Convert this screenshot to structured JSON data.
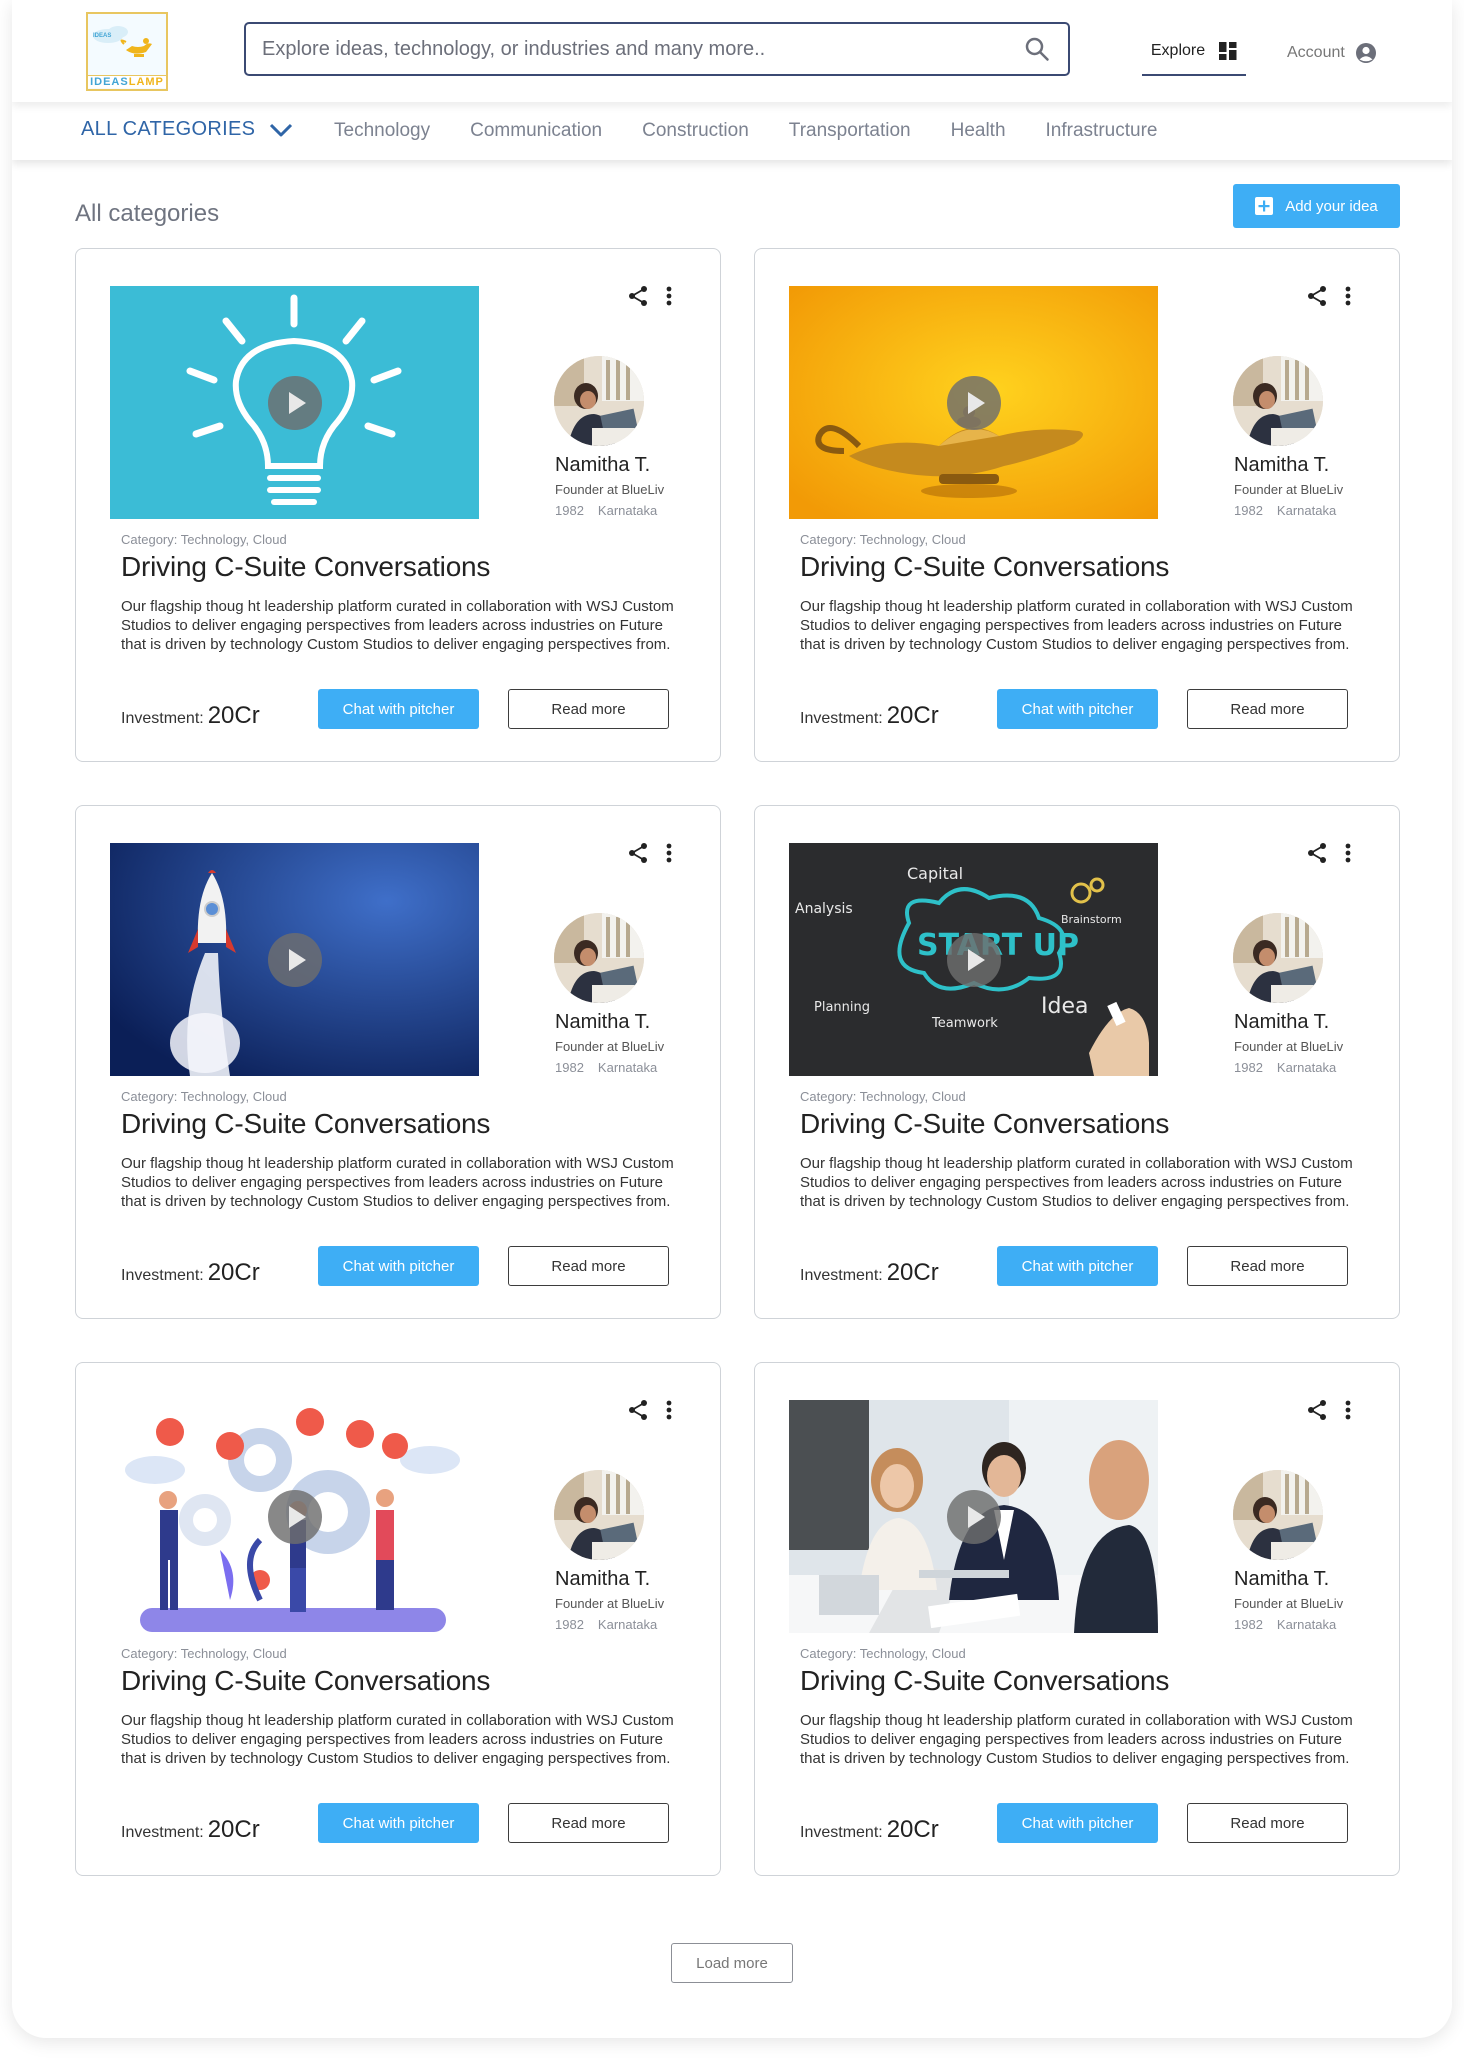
{
  "header": {
    "logo_text_main": "IDEAS",
    "logo_text_accent": "LAMP",
    "logo_small": "IDEAS",
    "search_placeholder": "Explore ideas, technology, or industries and many more..",
    "explore_label": "Explore",
    "account_label": "Account"
  },
  "category_nav": {
    "all_label": "ALL CATEGORIES",
    "links": [
      "Technology",
      "Communication",
      "Construction",
      "Transportation",
      "Health",
      "Infrastructure"
    ]
  },
  "main": {
    "section_title": "All categories",
    "add_button_label": "Add your idea",
    "load_more_label": "Load more"
  },
  "cards": [
    {
      "media": "lightbulb",
      "person_name": "Namitha T.",
      "person_role": "Founder at BlueLiv",
      "person_year": "1982",
      "person_location": "Karnataka",
      "category": "Category: Technology, Cloud",
      "title": "Driving C-Suite Conversations",
      "description": "Our flagship thoug ht leadership platform curated in collaboration with WSJ Custom Studios to deliver engaging perspectives from leaders across industries on Future that is driven by technology Custom Studios to deliver engaging perspectives from.",
      "investment_label": "Investment:",
      "investment_value": "20Cr",
      "chat_label": "Chat with pitcher",
      "read_label": "Read more"
    },
    {
      "media": "lamp",
      "person_name": "Namitha T.",
      "person_role": "Founder at BlueLiv",
      "person_year": "1982",
      "person_location": "Karnataka",
      "category": "Category: Technology, Cloud",
      "title": "Driving C-Suite Conversations",
      "description": "Our flagship thoug ht leadership platform curated in collaboration with WSJ Custom Studios to deliver engaging perspectives from leaders across industries on Future that is driven by technology Custom Studios to deliver engaging perspectives from.",
      "investment_label": "Investment:",
      "investment_value": "20Cr",
      "chat_label": "Chat with pitcher",
      "read_label": "Read more"
    },
    {
      "media": "rocket",
      "person_name": "Namitha T.",
      "person_role": "Founder at BlueLiv",
      "person_year": "1982",
      "person_location": "Karnataka",
      "category": "Category: Technology, Cloud",
      "title": "Driving C-Suite Conversations",
      "description": "Our flagship thoug ht leadership platform curated in collaboration with WSJ Custom Studios to deliver engaging perspectives from leaders across industries on Future that is driven by technology Custom Studios to deliver engaging perspectives from.",
      "investment_label": "Investment:",
      "investment_value": "20Cr",
      "chat_label": "Chat with pitcher",
      "read_label": "Read more"
    },
    {
      "media": "chalkboard",
      "person_name": "Namitha T.",
      "person_role": "Founder at BlueLiv",
      "person_year": "1982",
      "person_location": "Karnataka",
      "category": "Category: Technology, Cloud",
      "title": "Driving C-Suite Conversations",
      "description": "Our flagship thoug ht leadership platform curated in collaboration with WSJ Custom Studios to deliver engaging perspectives from leaders across industries on Future that is driven by technology Custom Studios to deliver engaging perspectives from.",
      "investment_label": "Investment:",
      "investment_value": "20Cr",
      "chat_label": "Chat with pitcher",
      "read_label": "Read more"
    },
    {
      "media": "teamwork",
      "person_name": "Namitha T.",
      "person_role": "Founder at BlueLiv",
      "person_year": "1982",
      "person_location": "Karnataka",
      "category": "Category: Technology, Cloud",
      "title": "Driving C-Suite Conversations",
      "description": "Our flagship thoug ht leadership platform curated in collaboration with WSJ Custom Studios to deliver engaging perspectives from leaders across industries on Future that is driven by technology Custom Studios to deliver engaging perspectives from.",
      "investment_label": "Investment:",
      "investment_value": "20Cr",
      "chat_label": "Chat with pitcher",
      "read_label": "Read more"
    },
    {
      "media": "meeting",
      "person_name": "Namitha T.",
      "person_role": "Founder at BlueLiv",
      "person_year": "1982",
      "person_location": "Karnataka",
      "category": "Category: Technology, Cloud",
      "title": "Driving C-Suite Conversations",
      "description": "Our flagship thoug ht leadership platform curated in collaboration with WSJ Custom Studios to deliver engaging perspectives from leaders across industries on Future that is driven by technology Custom Studios to deliver engaging perspectives from.",
      "investment_label": "Investment:",
      "investment_value": "20Cr",
      "chat_label": "Chat with pitcher",
      "read_label": "Read more"
    }
  ],
  "chalkboard_words": [
    "Capital",
    "Analysis",
    "Brainstorm",
    "START UP",
    "Planning",
    "Teamwork",
    "Idea"
  ],
  "colors": {
    "accent": "#3eaef5",
    "brand_blue": "#2f65a7",
    "border": "#cfd3d8",
    "dark_navy": "#3b4a73"
  },
  "icons": [
    "search-icon",
    "grid-icon",
    "account-icon",
    "chevron-down-icon",
    "plus-icon",
    "share-icon",
    "more-vertical-icon",
    "play-icon"
  ]
}
